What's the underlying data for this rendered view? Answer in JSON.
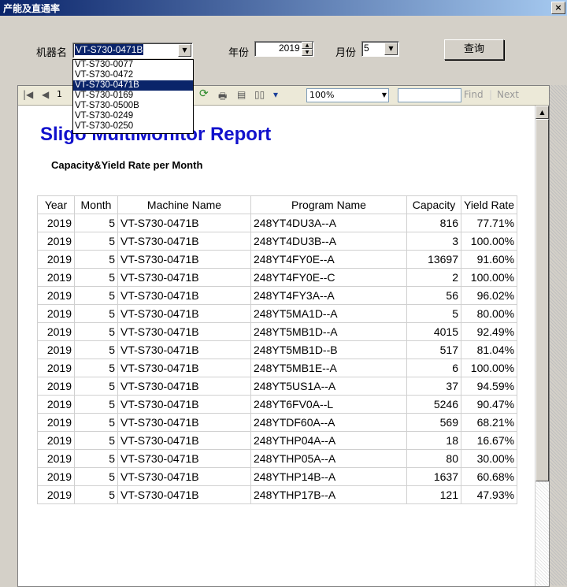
{
  "window": {
    "title": "产能及直通率",
    "close_label": "×"
  },
  "form": {
    "machine_label": "机器名",
    "machine_value": "VT-S730-0471B",
    "year_label": "年份",
    "year_value": "2019",
    "month_label": "月份",
    "month_value": "5",
    "query_label": "查询"
  },
  "machine_dropdown": {
    "options": [
      "VT-S730-0077",
      "VT-S730-0472",
      "VT-S730-0471B",
      "VT-S730-0169",
      "VT-S730-0500B",
      "VT-S730-0249",
      "VT-S730-0250"
    ],
    "selected_index": 2
  },
  "toolbar": {
    "page_value": "1",
    "zoom_value": "100%",
    "find_label": "Find",
    "separator": "|",
    "next_label": "Next"
  },
  "report": {
    "title": "Sligo MultiMonitor Report",
    "subtitle": "Capacity&Yield Rate per Month",
    "columns": [
      "Year",
      "Month",
      "Machine Name",
      "Program Name",
      "Capacity",
      "Yield Rate"
    ],
    "rows": [
      [
        "2019",
        "5",
        "VT-S730-0471B",
        "248YT4DU3A--A",
        "816",
        "77.71%"
      ],
      [
        "2019",
        "5",
        "VT-S730-0471B",
        "248YT4DU3B--A",
        "3",
        "100.00%"
      ],
      [
        "2019",
        "5",
        "VT-S730-0471B",
        "248YT4FY0E--A",
        "13697",
        "91.60%"
      ],
      [
        "2019",
        "5",
        "VT-S730-0471B",
        "248YT4FY0E--C",
        "2",
        "100.00%"
      ],
      [
        "2019",
        "5",
        "VT-S730-0471B",
        "248YT4FY3A--A",
        "56",
        "96.02%"
      ],
      [
        "2019",
        "5",
        "VT-S730-0471B",
        "248YT5MA1D--A",
        "5",
        "80.00%"
      ],
      [
        "2019",
        "5",
        "VT-S730-0471B",
        "248YT5MB1D--A",
        "4015",
        "92.49%"
      ],
      [
        "2019",
        "5",
        "VT-S730-0471B",
        "248YT5MB1D--B",
        "517",
        "81.04%"
      ],
      [
        "2019",
        "5",
        "VT-S730-0471B",
        "248YT5MB1E--A",
        "6",
        "100.00%"
      ],
      [
        "2019",
        "5",
        "VT-S730-0471B",
        "248YT5US1A--A",
        "37",
        "94.59%"
      ],
      [
        "2019",
        "5",
        "VT-S730-0471B",
        "248YT6FV0A--L",
        "5246",
        "90.47%"
      ],
      [
        "2019",
        "5",
        "VT-S730-0471B",
        "248YTDF60A--A",
        "569",
        "68.21%"
      ],
      [
        "2019",
        "5",
        "VT-S730-0471B",
        "248YTHP04A--A",
        "18",
        "16.67%"
      ],
      [
        "2019",
        "5",
        "VT-S730-0471B",
        "248YTHP05A--A",
        "80",
        "30.00%"
      ],
      [
        "2019",
        "5",
        "VT-S730-0471B",
        "248YTHP14B--A",
        "1637",
        "60.68%"
      ],
      [
        "2019",
        "5",
        "VT-S730-0471B",
        "248YTHP17B--A",
        "121",
        "47.93%"
      ]
    ]
  }
}
